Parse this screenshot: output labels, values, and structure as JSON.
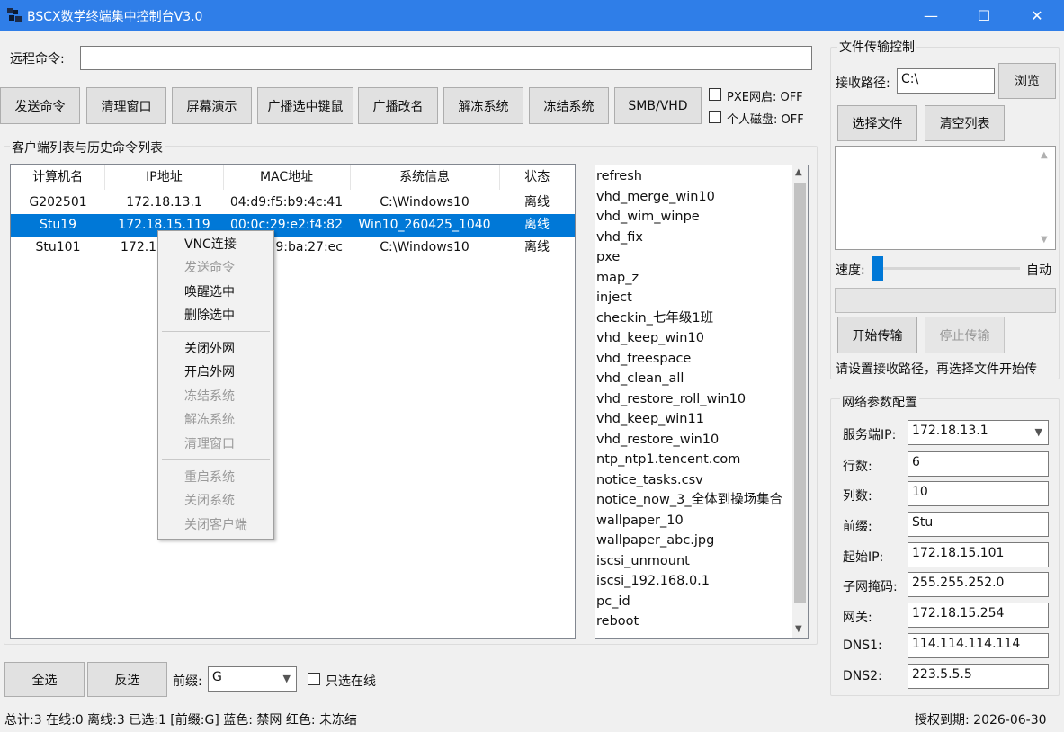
{
  "window": {
    "title": "BSCX数学终端集中控制台V3.0",
    "minimize": "—",
    "maximize": "☐",
    "close": "✕",
    "accent": "#2f7ee8"
  },
  "command": {
    "label": "远程命令:",
    "value": ""
  },
  "toolbar": {
    "send": "发送命令",
    "clear": "清理窗口",
    "screen": "屏幕演示",
    "broadcast_kbd": "广播选中键鼠",
    "broadcast_rename": "广播改名",
    "unfreeze": "解冻系统",
    "freeze": "冻结系统",
    "smb": "SMB/VHD",
    "pxe": "PXE网启: OFF",
    "disk": "个人磁盘: OFF"
  },
  "client_section": {
    "title": "客户端列表与历史命令列表"
  },
  "table": {
    "headers": [
      "计算机名",
      "IP地址",
      "MAC地址",
      "系统信息",
      "状态"
    ],
    "rows": [
      [
        "G202501",
        "172.18.13.1",
        "04:d9:f5:b9:4c:41",
        "C:\\Windows10",
        "离线"
      ],
      [
        "Stu19",
        "172.18.15.119",
        "00:0c:29:e2:f4:82",
        "Win10_260425_1040",
        "离线"
      ],
      [
        "Stu101",
        "172.18",
        "29:ba:27:ec",
        "C:\\Windows10",
        "离线"
      ]
    ],
    "selected_color": "#0078d7"
  },
  "history": [
    "refresh",
    "vhd_merge_win10",
    "vhd_wim_winpe",
    "vhd_fix",
    "pxe",
    "map_z",
    "inject",
    "checkin_七年级1班",
    "vhd_keep_win10",
    "vhd_freespace",
    "vhd_clean_all",
    "vhd_restore_roll_win10",
    "vhd_keep_win11",
    "vhd_restore_win10",
    "ntp_ntp1.tencent.com",
    "notice_tasks.csv",
    "notice_now_3_全体到操场集合",
    "wallpaper_10",
    "wallpaper_abc.jpg",
    "iscsi_unmount",
    "iscsi_192.168.0.1",
    "pc_id",
    "reboot"
  ],
  "context_menu": {
    "vnc": "VNC连接",
    "send": "发送命令",
    "wake": "唤醒选中",
    "delete": "删除选中",
    "net_off": "关闭外网",
    "net_on": "开启外网",
    "freeze": "冻结系统",
    "unfreeze": "解冻系统",
    "clean": "清理窗口",
    "restart": "重启系统",
    "shutdown": "关闭系统",
    "close_client": "关闭客户端"
  },
  "file_transfer": {
    "title": "文件传输控制",
    "path_label": "接收路径:",
    "path_value": "C:\\",
    "browse": "浏览",
    "choose": "选择文件",
    "clear_list": "清空列表",
    "speed_label": "速度:",
    "speed_value": "自动",
    "speed_level": 0,
    "start": "开始传输",
    "stop": "停止传输",
    "hint": "请设置接收路径，再选择文件开始传"
  },
  "network": {
    "title": "网络参数配置",
    "server_ip_label": "服务端IP:",
    "server_ip": "172.18.13.1",
    "rows_label": "行数:",
    "rows": "6",
    "cols_label": "列数:",
    "cols": "10",
    "prefix_label": "前缀:",
    "prefix": "Stu",
    "start_ip_label": "起始IP:",
    "start_ip": "172.18.15.101",
    "mask_label": "子网掩码:",
    "mask": "255.255.252.0",
    "gateway_label": "网关:",
    "gateway": "172.18.15.254",
    "dns1_label": "DNS1:",
    "dns1": "114.114.114.114",
    "dns2_label": "DNS2:",
    "dns2": "223.5.5.5"
  },
  "bottom": {
    "select_all": "全选",
    "invert": "反选",
    "prefix_label": "前缀:",
    "prefix_value": "G",
    "online_only": "只选在线"
  },
  "status": {
    "summary": "总计:3  在线:0  离线:3  已选:1   [前缀:G]  蓝色: 禁网  红色: 未冻结",
    "license": "授权到期: 2026-06-30"
  }
}
